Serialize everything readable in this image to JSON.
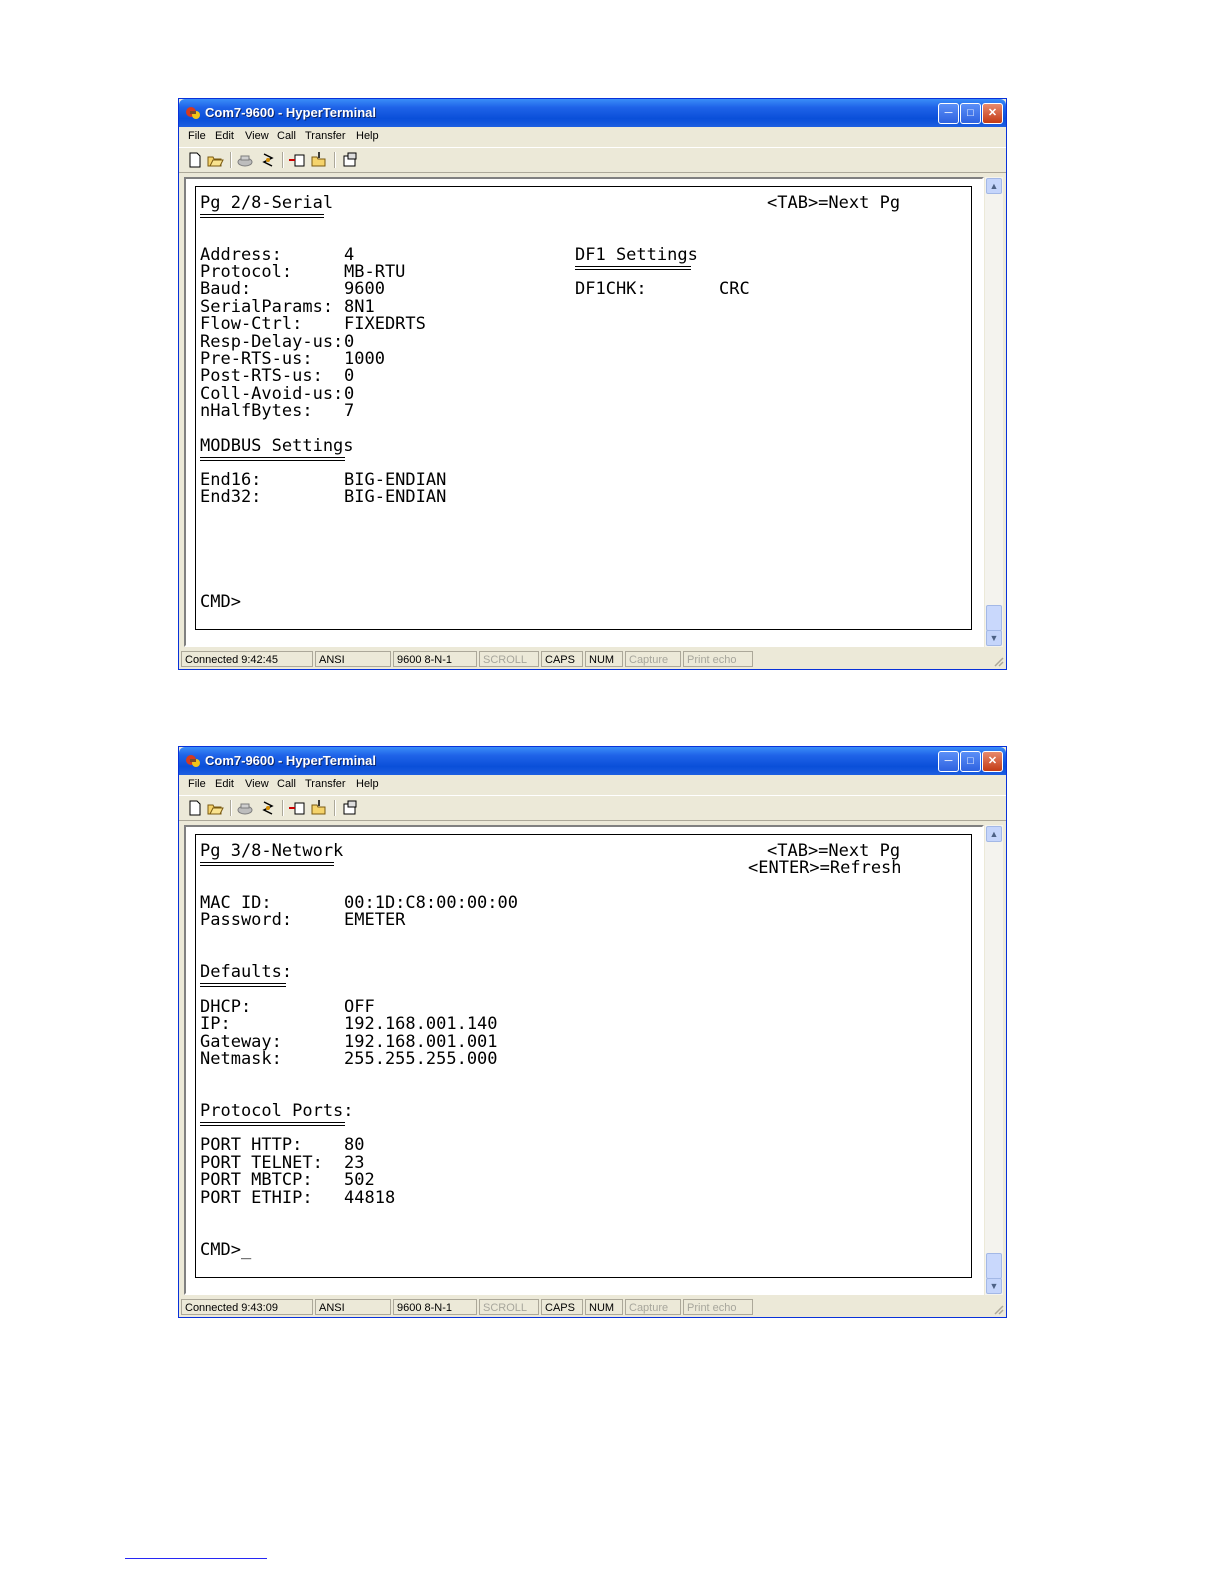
{
  "windows": [
    {
      "title": "Com7-9600 - HyperTerminal",
      "menu": [
        "File",
        "Edit",
        "View",
        "Call",
        "Transfer",
        "Help"
      ],
      "toolbar_icons": [
        "new-icon",
        "open-icon",
        "phone-icon",
        "disconnect-icon",
        "send-icon",
        "receive-icon",
        "properties-icon"
      ],
      "page_title": "Pg 2/8-Serial",
      "hints": [
        "<TAB>=Next Pg"
      ],
      "settings": [
        {
          "label": "Address:",
          "value": "4"
        },
        {
          "label": "Protocol:",
          "value": "MB-RTU"
        },
        {
          "label": "Baud:",
          "value": "9600"
        },
        {
          "label": "SerialParams:",
          "value": "8N1"
        },
        {
          "label": "Flow-Ctrl:",
          "value": "FIXEDRTS"
        },
        {
          "label": "Resp-Delay-us:",
          "value": "0"
        },
        {
          "label": "Pre-RTS-us:",
          "value": "1000"
        },
        {
          "label": "Post-RTS-us:",
          "value": "0"
        },
        {
          "label": "Coll-Avoid-us:",
          "value": "0"
        },
        {
          "label": "nHalfBytes:",
          "value": "7"
        }
      ],
      "df1": {
        "heading": "DF1 Settings",
        "label": "DF1CHK:",
        "value": "CRC"
      },
      "modbus": {
        "heading": "MODBUS Settings",
        "rows": [
          {
            "label": "End16:",
            "value": "BIG-ENDIAN"
          },
          {
            "label": "End32:",
            "value": "BIG-ENDIAN"
          }
        ]
      },
      "prompt": "CMD>",
      "status": [
        "Connected 9:42:45",
        "ANSI",
        "9600 8-N-1",
        "SCROLL",
        "CAPS",
        "NUM",
        "Capture",
        "Print echo"
      ]
    },
    {
      "title": "Com7-9600 - HyperTerminal",
      "menu": [
        "File",
        "Edit",
        "View",
        "Call",
        "Transfer",
        "Help"
      ],
      "page_title": "Pg 3/8-Network",
      "hints": [
        "<TAB>=Next Pg",
        "<ENTER>=Refresh"
      ],
      "top_rows": [
        {
          "label": "MAC ID:",
          "value": "00:1D:C8:00:00:00"
        },
        {
          "label": "Password:",
          "value": "EMETER"
        }
      ],
      "defaults": {
        "heading": "Defaults:",
        "rows": [
          {
            "label": "DHCP:",
            "value": "OFF"
          },
          {
            "label": "IP:",
            "value": "192.168.001.140"
          },
          {
            "label": "Gateway:",
            "value": "192.168.001.001"
          },
          {
            "label": "Netmask:",
            "value": "255.255.255.000"
          }
        ]
      },
      "ports": {
        "heading": "Protocol Ports:",
        "rows": [
          {
            "label": "PORT HTTP:",
            "value": "80"
          },
          {
            "label": "PORT TELNET:",
            "value": "23"
          },
          {
            "label": "PORT MBTCP:",
            "value": "502"
          },
          {
            "label": "PORT ETHIP:",
            "value": "44818"
          }
        ]
      },
      "prompt": "CMD>_",
      "status": [
        "Connected 9:43:09",
        "ANSI",
        "9600 8-N-1",
        "SCROLL",
        "CAPS",
        "NUM",
        "Capture",
        "Print echo"
      ]
    }
  ],
  "colors": {
    "titlebar": "#0a4fd9",
    "chrome": "#ece9d8",
    "terminal_bg": "#ffffff",
    "dim_text": "#a7a69c"
  }
}
